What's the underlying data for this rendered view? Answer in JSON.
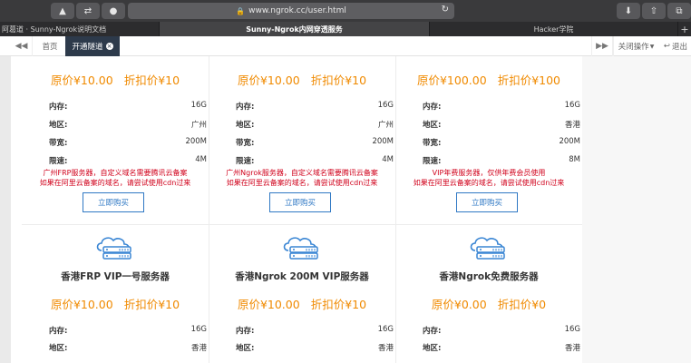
{
  "browser": {
    "url": "www.ngrok.cc/user.html",
    "tabs": [
      "阿葛道 · Sunny-Ngrok说明文档",
      "Sunny-Ngrok内网穿透服务",
      "Hacker学院"
    ],
    "plus": "+"
  },
  "appbar": {
    "home": "首页",
    "current": "开通隧道",
    "close_ops": "关闭操作",
    "logout": "退出"
  },
  "cards_top": [
    {
      "price": "原价¥10.00",
      "discount": "折扣价¥10",
      "specs": [
        [
          "内存:",
          "16G"
        ],
        [
          "地区:",
          "广州"
        ],
        [
          "带宽:",
          "200M"
        ],
        [
          "限速:",
          "4M"
        ]
      ],
      "note1": "广州FRP服务器，自定义域名需要腾讯云备案",
      "note2": "如果在阿里云备案的域名，请尝试使用cdn过来",
      "button": "立即购买"
    },
    {
      "price": "原价¥10.00",
      "discount": "折扣价¥10",
      "specs": [
        [
          "内存:",
          "16G"
        ],
        [
          "地区:",
          "广州"
        ],
        [
          "带宽:",
          "200M"
        ],
        [
          "限速:",
          "4M"
        ]
      ],
      "note1": "广州Ngrok服务器，自定义域名需要腾讯云备案",
      "note2": "如果在阿里云备案的域名，请尝试使用cdn过来",
      "button": "立即购买"
    },
    {
      "price": "原价¥100.00",
      "discount": "折扣价¥100",
      "specs": [
        [
          "内存:",
          "16G"
        ],
        [
          "地区:",
          "香港"
        ],
        [
          "带宽:",
          "200M"
        ],
        [
          "限速:",
          "8M"
        ]
      ],
      "note1": "VIP年费服务器，仅供年费会员使用",
      "note2": "如果在阿里云备案的域名，请尝试使用cdn过来",
      "button": "立即购买"
    }
  ],
  "cards_bottom": [
    {
      "title": "香港FRP VIP一号服务器",
      "price": "原价¥10.00",
      "discount": "折扣价¥10",
      "specs": [
        [
          "内存:",
          "16G"
        ],
        [
          "地区:",
          "香港"
        ]
      ]
    },
    {
      "title": "香港Ngrok 200M VIP服务器",
      "price": "原价¥10.00",
      "discount": "折扣价¥10",
      "specs": [
        [
          "内存:",
          "16G"
        ],
        [
          "地区:",
          "香港"
        ]
      ]
    },
    {
      "title": "香港Ngrok免费服务器",
      "price": "原价¥0.00",
      "discount": "折扣价¥0",
      "specs": [
        [
          "内存:",
          "16G"
        ],
        [
          "地区:",
          "香港"
        ]
      ]
    }
  ],
  "colors": {
    "price": "#f08a00",
    "note": "#d0011b",
    "button": "#2f78c4",
    "icon": "#3a86d4"
  }
}
